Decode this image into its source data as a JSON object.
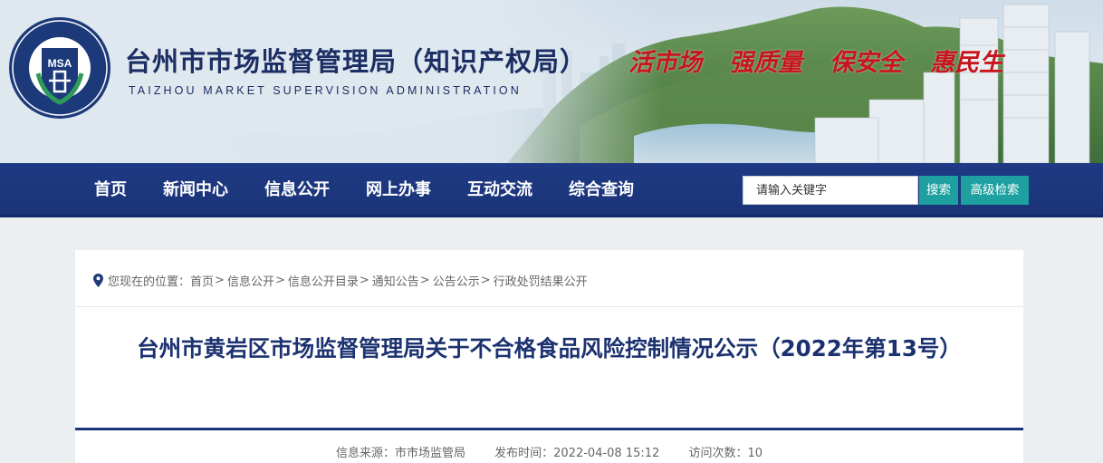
{
  "header": {
    "logo_text": "MSA",
    "logo_ring_cn": "台州市场监督管理",
    "logo_ring_en": "TAIZHOU MARKET SUPERVISION ADMINISTRATION",
    "title_cn": "台州市市场监督管理局（知识产权局）",
    "title_en": "TAIZHOU MARKET SUPERVISION ADMINISTRATION",
    "slogans": [
      "活市场",
      "强质量",
      "保安全",
      "惠民生"
    ],
    "slogan_color": "#c8141b"
  },
  "nav": {
    "items": [
      "首页",
      "新闻中心",
      "信息公开",
      "网上办事",
      "互动交流",
      "综合查询"
    ],
    "search_placeholder": "请输入关键字",
    "search_label": "搜索",
    "advanced_label": "高级检索",
    "bar_color": "#1f3a84",
    "button_color": "#1ea0a0"
  },
  "breadcrumb": {
    "prefix": "您现在的位置：",
    "items": [
      "首页",
      "信息公开",
      "信息公开目录",
      "通知公告",
      "公告公示",
      "行政处罚结果公开"
    ],
    "separator": ">"
  },
  "article": {
    "title": "台州市黄岩区市场监督管理局关于不合格食品风险控制情况公示（2022年第13号）",
    "source": "信息来源：市市场监管局",
    "publish_time": "发布时间：2022-04-08 15:12",
    "views": "访问次数：10"
  }
}
